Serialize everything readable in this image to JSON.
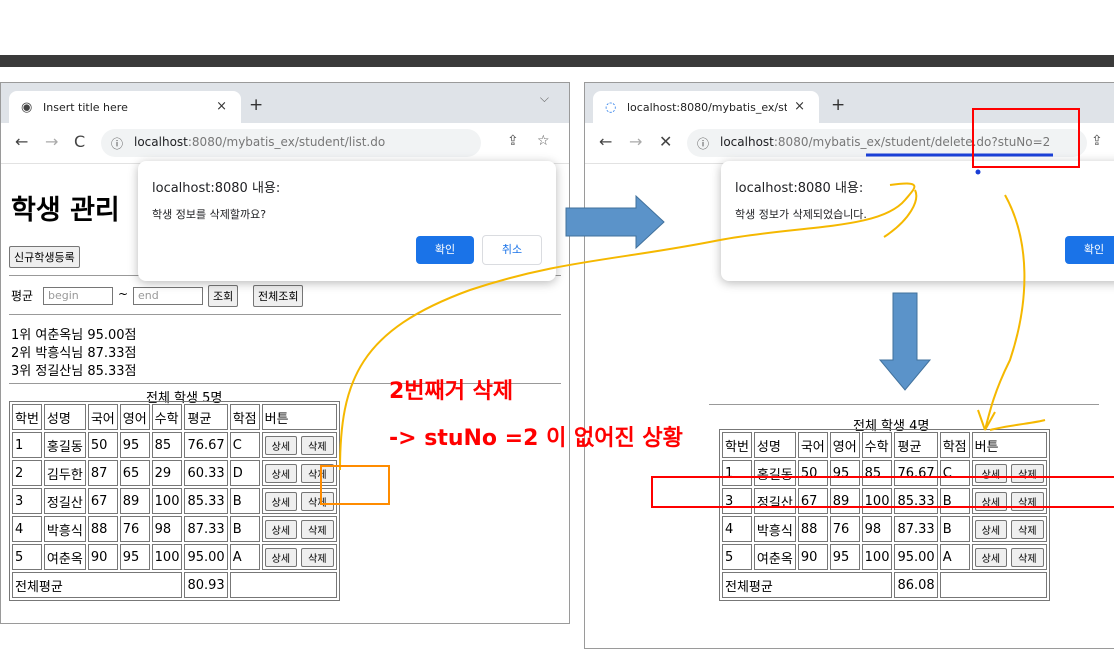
{
  "left_browser": {
    "tab_title": "Insert title here",
    "tab_close": "×",
    "new_tab": "+",
    "tab_menu": "⌵",
    "url_host": "localhost",
    "url_rest": ":8080/mybatis_ex/student/list.do",
    "page_title": "학생 관리",
    "new_student_button": "신규학생등록",
    "avg_label": "평균",
    "begin_placeholder": "begin",
    "range_sep": "~",
    "end_placeholder": "end",
    "search_button": "조회",
    "search_all_button": "전체조회",
    "ranks": [
      "1위 여춘옥님 95.00점",
      "2위 박흥식님 87.33점",
      "3위 정길산님 85.33점"
    ],
    "table_caption": "전체 학생 5명",
    "headers": [
      "학번",
      "성명",
      "국어",
      "영어",
      "수학",
      "평균",
      "학점",
      "버튼"
    ],
    "rows": [
      {
        "no": "1",
        "name": "홍길동",
        "kor": "50",
        "eng": "95",
        "math": "85",
        "avg": "76.67",
        "grade": "C"
      },
      {
        "no": "2",
        "name": "김두한",
        "kor": "87",
        "eng": "65",
        "math": "29",
        "avg": "60.33",
        "grade": "D"
      },
      {
        "no": "3",
        "name": "정길산",
        "kor": "67",
        "eng": "89",
        "math": "100",
        "avg": "85.33",
        "grade": "B"
      },
      {
        "no": "4",
        "name": "박흥식",
        "kor": "88",
        "eng": "76",
        "math": "98",
        "avg": "87.33",
        "grade": "B"
      },
      {
        "no": "5",
        "name": "여춘옥",
        "kor": "90",
        "eng": "95",
        "math": "100",
        "avg": "95.00",
        "grade": "A"
      }
    ],
    "detail_button": "상세",
    "delete_button": "삭제",
    "total_label": "전체평균",
    "total_avg": "80.93",
    "dialog": {
      "title": "localhost:8080 내용:",
      "message": "학생 정보를 삭제할까요?",
      "ok": "확인",
      "cancel": "취소"
    }
  },
  "right_browser": {
    "tab_title": "localhost:8080/mybatis_ex/stude",
    "tab_close": "×",
    "new_tab": "+",
    "url_host": "localhost",
    "url_rest": ":8080/mybatis_ex/student/delete.do?stuNo=2",
    "table_caption": "전체 학생 4명",
    "headers": [
      "학번",
      "성명",
      "국어",
      "영어",
      "수학",
      "평균",
      "학점",
      "버튼"
    ],
    "rows": [
      {
        "no": "1",
        "name": "홍길동",
        "kor": "50",
        "eng": "95",
        "math": "85",
        "avg": "76.67",
        "grade": "C"
      },
      {
        "no": "3",
        "name": "정길산",
        "kor": "67",
        "eng": "89",
        "math": "100",
        "avg": "85.33",
        "grade": "B"
      },
      {
        "no": "4",
        "name": "박흥식",
        "kor": "88",
        "eng": "76",
        "math": "98",
        "avg": "87.33",
        "grade": "B"
      },
      {
        "no": "5",
        "name": "여춘옥",
        "kor": "90",
        "eng": "95",
        "math": "100",
        "avg": "95.00",
        "grade": "A"
      }
    ],
    "detail_button": "상세",
    "delete_button": "삭제",
    "total_label": "전체평균",
    "total_avg": "86.08",
    "dialog": {
      "title": "localhost:8080 내용:",
      "message": "학생 정보가 삭제되었습니다.",
      "ok": "확인"
    }
  },
  "annotations": {
    "line1": "2번째거 삭제",
    "line2": "-> stuNo =2 이 없어진 상황"
  },
  "colors": {
    "annotation_red": "#ff0000",
    "arrow_blue": "#5b93c9",
    "scribble_yellow": "#f5b800",
    "underline_blue": "#1a3fd6",
    "highlight_orange": "#ff8c00"
  }
}
